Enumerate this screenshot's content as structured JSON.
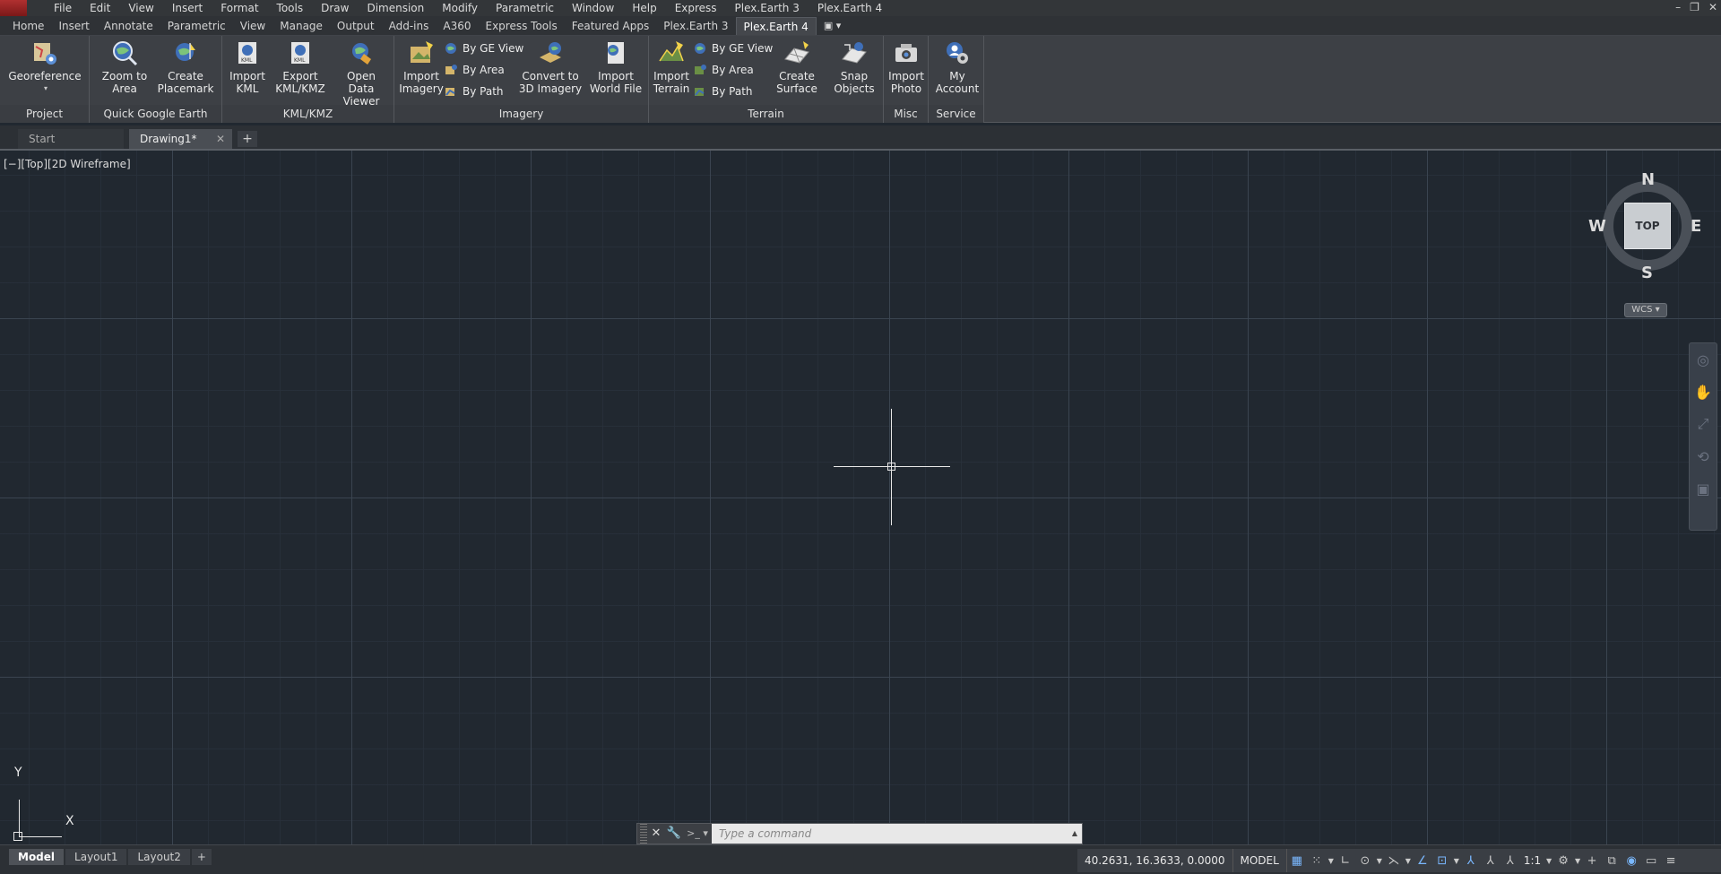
{
  "menubar": {
    "items": [
      "File",
      "Edit",
      "View",
      "Insert",
      "Format",
      "Tools",
      "Draw",
      "Dimension",
      "Modify",
      "Parametric",
      "Window",
      "Help",
      "Express",
      "Plex.Earth 3",
      "Plex.Earth 4"
    ],
    "window_controls": [
      "–",
      "❐",
      "✕"
    ]
  },
  "ribbon_tabs": {
    "items": [
      "Home",
      "Insert",
      "Annotate",
      "Parametric",
      "View",
      "Manage",
      "Output",
      "Add-ins",
      "A360",
      "Express Tools",
      "Featured Apps",
      "Plex.Earth 3",
      "Plex.Earth 4"
    ],
    "active": "Plex.Earth 4",
    "extra": "▣ ▾"
  },
  "ribbon": {
    "panels": {
      "project": "Project",
      "quick_google_earth": "Quick Google Earth",
      "kml": "KML/KMZ",
      "imagery": "Imagery",
      "terrain": "Terrain",
      "misc": "Misc",
      "service": "Service"
    },
    "buttons": {
      "georeference": [
        "Georeference",
        "▾"
      ],
      "zoom_to_area": [
        "Zoom to",
        "Area"
      ],
      "create_placemark": [
        "Create",
        "Placemark"
      ],
      "import_kml": [
        "Import",
        "KML"
      ],
      "export_kml": [
        "Export",
        "KML/KMZ"
      ],
      "open_data_viewer": [
        "Open",
        "Data Viewer"
      ],
      "import_imagery": [
        "Import",
        "Imagery"
      ],
      "imagery_by_ge_view": "By GE View",
      "imagery_by_area": "By Area",
      "imagery_by_path": "By Path",
      "convert_3d": [
        "Convert to",
        "3D Imagery"
      ],
      "import_world_file": [
        "Import",
        "World File"
      ],
      "import_terrain": [
        "Import",
        "Terrain"
      ],
      "terrain_by_ge_view": "By GE View",
      "terrain_by_area": "By Area",
      "terrain_by_path": "By Path",
      "create_surface": [
        "Create",
        "Surface"
      ],
      "snap_objects": [
        "Snap",
        "Objects"
      ],
      "import_photo": [
        "Import",
        "Photo"
      ],
      "my_account": [
        "My",
        "Account"
      ]
    }
  },
  "file_tabs": {
    "start": "Start",
    "drawing": "Drawing1*",
    "close": "✕",
    "add": "+"
  },
  "viewport": {
    "label": "[−][Top][2D Wireframe]",
    "viewcube": {
      "face": "TOP",
      "n": "N",
      "s": "S",
      "e": "E",
      "w": "W"
    },
    "wcs": "WCS ▾",
    "ucs": {
      "x": "X",
      "y": "Y"
    }
  },
  "command_line": {
    "placeholder": "Type a command",
    "close": "✕",
    "customize": "🔧",
    "prompt": ">_ ▾",
    "history": "▲"
  },
  "layout_tabs": {
    "items": [
      "Model",
      "Layout1",
      "Layout2"
    ],
    "active": "Model",
    "add": "+"
  },
  "statusbar": {
    "coordinates": "40.2631, 16.3633, 0.0000",
    "space": "MODEL",
    "scale": "1:1"
  },
  "colors": {
    "canvas": "#212830",
    "ribbon": "#3d4045",
    "accent": "#7ab8ff"
  }
}
